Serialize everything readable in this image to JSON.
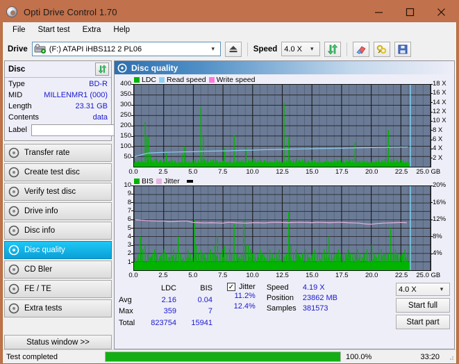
{
  "window": {
    "title": "Opti Drive Control 1.70",
    "icon": "disc-icon",
    "minimize": "minimize-icon",
    "maximize": "maximize-icon",
    "close": "close-icon"
  },
  "menu": {
    "items": [
      "File",
      "Start test",
      "Extra",
      "Help"
    ]
  },
  "toolbar": {
    "drive_label": "Drive",
    "drive_value": "(F:)   ATAPI iHBS112   2 PL06",
    "eject_icon": "eject-icon",
    "speed_label": "Speed",
    "speed_value": "4.0 X",
    "refresh_icon": "refresh-icon",
    "erase_icon": "eraser-icon",
    "plug_icon": "connector-icon",
    "save_icon": "save-icon"
  },
  "disc_panel": {
    "title": "Disc",
    "refresh_icon": "refresh-icon",
    "rows": [
      {
        "key": "Type",
        "value": "BD-R"
      },
      {
        "key": "MID",
        "value": "MILLENMR1 (000)"
      },
      {
        "key": "Length",
        "value": "23.31 GB"
      },
      {
        "key": "Contents",
        "value": "data"
      }
    ],
    "label_key": "Label",
    "label_value": "",
    "label_placeholder": "",
    "label_button_icon": "disc-icon"
  },
  "sidebar": {
    "items": [
      {
        "label": "Transfer rate",
        "active": false
      },
      {
        "label": "Create test disc",
        "active": false
      },
      {
        "label": "Verify test disc",
        "active": false
      },
      {
        "label": "Drive info",
        "active": false
      },
      {
        "label": "Disc info",
        "active": false
      },
      {
        "label": "Disc quality",
        "active": true
      },
      {
        "label": "CD Bler",
        "active": false
      },
      {
        "label": "FE / TE",
        "active": false
      },
      {
        "label": "Extra tests",
        "active": false
      }
    ],
    "status_button": "Status window >>"
  },
  "panel": {
    "title": "Disc quality",
    "icon": "disc-quality-icon"
  },
  "chart_data": [
    {
      "type": "line",
      "title": "Disc quality - LDC",
      "xlabel": "GB",
      "ylabel": "LDC",
      "xlim": [
        0,
        25
      ],
      "ylim": [
        0,
        400
      ],
      "grid": true,
      "legend": [
        {
          "name": "LDC",
          "color": "#00b400"
        },
        {
          "name": "Read speed",
          "color": "#8ecff0"
        },
        {
          "name": "Write speed",
          "color": "#ff77e0"
        }
      ],
      "xticks": [
        "0.0",
        "2.5",
        "5.0",
        "7.5",
        "10.0",
        "12.5",
        "15.0",
        "17.5",
        "20.0",
        "22.5",
        "25.0 GB"
      ],
      "yticks_left": [
        "400",
        "350",
        "300",
        "250",
        "200",
        "150",
        "100",
        "50"
      ],
      "yticks_right": [
        "18 X",
        "16 X",
        "14 X",
        "12 X",
        "10 X",
        "8 X",
        "6 X",
        "4 X",
        "2 X"
      ],
      "right_axis_lim": [
        0,
        18
      ],
      "series": [
        {
          "name": "LDC",
          "color": "#00b400",
          "axis": "left",
          "x": [
            0.05,
            0.15,
            0.3,
            0.45,
            0.6,
            0.75,
            0.9,
            1.05,
            1.2,
            1.35,
            1.5,
            1.65,
            1.8,
            1.95,
            2.1,
            2.25,
            2.4,
            2.55,
            2.7,
            2.85,
            3.0,
            3.2,
            3.4,
            3.6,
            3.8,
            4.0,
            4.2,
            4.4,
            4.6,
            4.8,
            5.0,
            5.2,
            5.4,
            5.6,
            5.8,
            6.0,
            6.2,
            6.4,
            6.6,
            6.8,
            7.0,
            7.2,
            7.4,
            7.6,
            7.8,
            8.0,
            8.2,
            8.4,
            8.6,
            8.8,
            9.0,
            9.2,
            9.4,
            9.6,
            9.8,
            10.0,
            10.2,
            10.4,
            10.6,
            10.8,
            11.0,
            11.2,
            11.4,
            11.6,
            11.8,
            12.0,
            12.2,
            12.4,
            12.6,
            12.8,
            13.0,
            13.2,
            13.4,
            13.6,
            13.8,
            14.0,
            14.2,
            14.4,
            14.6,
            14.8,
            15.0,
            15.2,
            15.4,
            15.6,
            15.8,
            16.0,
            16.2,
            16.4,
            16.6,
            16.8,
            17.0,
            17.2,
            17.4,
            17.6,
            17.8,
            18.0,
            18.2,
            18.4,
            18.6,
            18.8,
            19.0,
            19.2,
            19.4,
            19.6,
            19.8,
            20.0,
            20.2,
            20.4,
            20.6,
            20.8,
            21.0,
            21.2,
            21.4,
            21.6,
            21.8,
            22.0,
            22.2,
            22.4,
            22.6,
            22.8,
            23.0,
            23.2
          ],
          "y": [
            28,
            22,
            30,
            26,
            33,
            25,
            218,
            150,
            145,
            60,
            30,
            24,
            34,
            22,
            27,
            31,
            20,
            24,
            70,
            28,
            22,
            26,
            30,
            18,
            24,
            62,
            100,
            26,
            30,
            22,
            34,
            20,
            26,
            290,
            150,
            30,
            26,
            24,
            36,
            22,
            28,
            20,
            24,
            90,
            26,
            30,
            22,
            155,
            26,
            24,
            30,
            22,
            95,
            26,
            30,
            24,
            28,
            20,
            26,
            22,
            30,
            24,
            28,
            22,
            26,
            36,
            30,
            24,
            312,
            26,
            145,
            30,
            24,
            28,
            22,
            26,
            30,
            24,
            28,
            22,
            26,
            30,
            24,
            28,
            22,
            26,
            30,
            24,
            28,
            22,
            26,
            30,
            24,
            28,
            22,
            26,
            30,
            24,
            120,
            26,
            30,
            22,
            26,
            30,
            24,
            28,
            22,
            26,
            30,
            24,
            28,
            22,
            180,
            26,
            30,
            24,
            28,
            22,
            26,
            20
          ]
        },
        {
          "name": "Read speed",
          "color": "#8ecff0",
          "axis": "right",
          "x": [
            0.05,
            0.6,
            1.2,
            2.0,
            3.0,
            4.0,
            5.0,
            6.0,
            7.0,
            8.0,
            9.0,
            10.0,
            11.0,
            12.0,
            13.0,
            14.0,
            15.0,
            16.0,
            17.0,
            18.0,
            19.0,
            20.0,
            21.0,
            22.0,
            23.1
          ],
          "y": [
            2.2,
            2.6,
            3.0,
            3.1,
            3.2,
            3.25,
            3.3,
            3.4,
            3.45,
            3.5,
            3.6,
            3.65,
            3.75,
            3.8,
            3.85,
            3.9,
            3.95,
            4.0,
            4.05,
            4.1,
            4.15,
            4.2,
            4.25,
            4.3,
            4.35
          ]
        }
      ]
    },
    {
      "type": "line",
      "title": "Disc quality - BIS / Jitter",
      "xlabel": "GB",
      "ylabel": "BIS",
      "xlim": [
        0,
        25
      ],
      "ylim": [
        0,
        10
      ],
      "grid": true,
      "legend": [
        {
          "name": "BIS",
          "color": "#00b400"
        },
        {
          "name": "Jitter",
          "color": "#e8b3e0"
        }
      ],
      "xticks": [
        "0.0",
        "2.5",
        "5.0",
        "7.5",
        "10.0",
        "12.5",
        "15.0",
        "17.5",
        "20.0",
        "22.5",
        "25.0 GB"
      ],
      "yticks_left": [
        "10",
        "9",
        "8",
        "7",
        "6",
        "5",
        "4",
        "3",
        "2",
        "1"
      ],
      "yticks_right": [
        "20%",
        "16%",
        "12%",
        "8%",
        "4%"
      ],
      "right_axis_lim": [
        0,
        20
      ],
      "series": [
        {
          "name": "BIS",
          "color": "#00b400",
          "axis": "left",
          "x": [
            0.1,
            0.3,
            0.5,
            0.7,
            0.9,
            1.1,
            1.3,
            1.5,
            1.7,
            1.9,
            2.1,
            2.3,
            2.5,
            2.7,
            2.9,
            3.1,
            3.3,
            3.5,
            3.7,
            3.9,
            4.1,
            4.3,
            4.5,
            4.7,
            4.9,
            5.05,
            5.2,
            5.4,
            5.6,
            5.8,
            6.0,
            6.2,
            6.4,
            6.6,
            6.8,
            7.0,
            7.2,
            7.4,
            7.6,
            7.8,
            8.0,
            8.2,
            8.4,
            8.6,
            8.8,
            9.0,
            9.2,
            9.4,
            9.6,
            9.8,
            10.0,
            10.2,
            10.4,
            10.6,
            10.8,
            11.0,
            11.2,
            11.4,
            11.6,
            11.8,
            12.0,
            12.2,
            12.4,
            12.6,
            12.8,
            13.0,
            13.2,
            13.4,
            13.6,
            13.8,
            14.0,
            14.2,
            14.4,
            14.6,
            14.8,
            15.0,
            15.2,
            15.4,
            15.6,
            15.8,
            16.0,
            16.2,
            16.4,
            16.6,
            16.8,
            17.0,
            17.2,
            17.4,
            17.6,
            17.8,
            18.0,
            18.2,
            18.4,
            18.6,
            18.8,
            19.0,
            19.2,
            19.4,
            19.6,
            19.8,
            20.0,
            20.2,
            20.4,
            20.6,
            20.8,
            21.0,
            21.2,
            21.4,
            21.6,
            21.8,
            22.0,
            22.2,
            22.4,
            22.6,
            22.8,
            23.0,
            23.2
          ],
          "y": [
            1.5,
            2,
            4,
            2.5,
            3,
            2,
            1.5,
            2,
            2.5,
            2,
            1.5,
            2,
            2.5,
            2,
            1.5,
            2,
            2.5,
            2,
            4,
            2,
            1.5,
            2,
            2.5,
            2,
            1.5,
            6,
            3,
            2,
            2.5,
            2,
            1.5,
            2,
            2.5,
            2,
            3,
            4,
            2,
            2.5,
            3,
            2,
            2.5,
            2,
            5.5,
            2,
            1.5,
            2,
            6,
            3,
            3,
            2.5,
            2,
            1.5,
            2,
            2.5,
            2,
            1.5,
            2,
            2.5,
            2,
            1.5,
            2,
            2.5,
            2,
            1.5,
            2,
            7,
            3,
            2,
            2.5,
            2,
            1.5,
            2,
            2.5,
            2,
            1.5,
            2,
            2.5,
            2,
            1.5,
            2,
            2.5,
            2,
            4,
            2,
            1.5,
            2,
            2.5,
            2,
            1.5,
            2,
            2.5,
            2,
            1.5,
            2,
            2.5,
            2,
            1.5,
            2,
            2.5,
            2,
            3,
            2,
            1.5,
            2,
            2.5,
            2,
            1.5,
            2,
            5,
            2,
            2.5,
            2,
            1.5,
            2,
            2.5,
            2,
            3,
            1.5
          ]
        },
        {
          "name": "Jitter",
          "color": "#e8b3e0",
          "axis": "right",
          "x": [
            0.1,
            0.5,
            1.0,
            1.5,
            2.0,
            2.5,
            3.0,
            3.5,
            4.0,
            4.5,
            5.0,
            5.5,
            6.0,
            6.5,
            7.0,
            7.5,
            8.0,
            8.5,
            9.0,
            9.5,
            10.0,
            10.5,
            11.0,
            11.5,
            12.0,
            12.5,
            13.0,
            13.5,
            14.0,
            14.5,
            15.0,
            15.5,
            16.0,
            16.5,
            17.0,
            17.5,
            18.0,
            18.5,
            19.0,
            19.5,
            20.0,
            20.5,
            21.0,
            21.5,
            22.0,
            22.5,
            23.0
          ],
          "y": [
            12.0,
            11.9,
            11.8,
            11.75,
            11.7,
            11.7,
            11.6,
            11.65,
            11.7,
            11.7,
            11.35,
            11.3,
            11.25,
            11.3,
            11.25,
            11.2,
            11.4,
            11.3,
            11.25,
            11.2,
            11.3,
            11.3,
            11.25,
            11.35,
            11.4,
            11.35,
            11.3,
            11.35,
            11.4,
            11.35,
            11.3,
            11.4,
            11.35,
            11.3,
            11.35,
            11.4,
            11.3,
            11.25,
            11.2,
            11.0,
            10.95,
            11.1,
            11.2,
            11.25,
            11.3,
            11.35,
            11.3
          ]
        }
      ]
    }
  ],
  "stats": {
    "col_headers": [
      "LDC",
      "BIS"
    ],
    "rows": [
      {
        "label": "Avg",
        "ldc": "2.16",
        "bis": "0.04"
      },
      {
        "label": "Max",
        "ldc": "359",
        "bis": "7"
      },
      {
        "label": "Total",
        "ldc": "823754",
        "bis": "15941"
      }
    ],
    "jitter": {
      "label": "Jitter",
      "checked": "✓",
      "avg": "11.2%",
      "max": "12.4%"
    },
    "info": [
      {
        "key": "Speed",
        "value": "4.19 X"
      },
      {
        "key": "Position",
        "value": "23862 MB"
      },
      {
        "key": "Samples",
        "value": "381573"
      }
    ],
    "speed_select": "4.0 X",
    "start_full": "Start full",
    "start_part": "Start part"
  },
  "statusbar": {
    "message": "Test completed",
    "progress_pct": "100.0%",
    "progress_value": 100,
    "elapsed": "33:20"
  }
}
